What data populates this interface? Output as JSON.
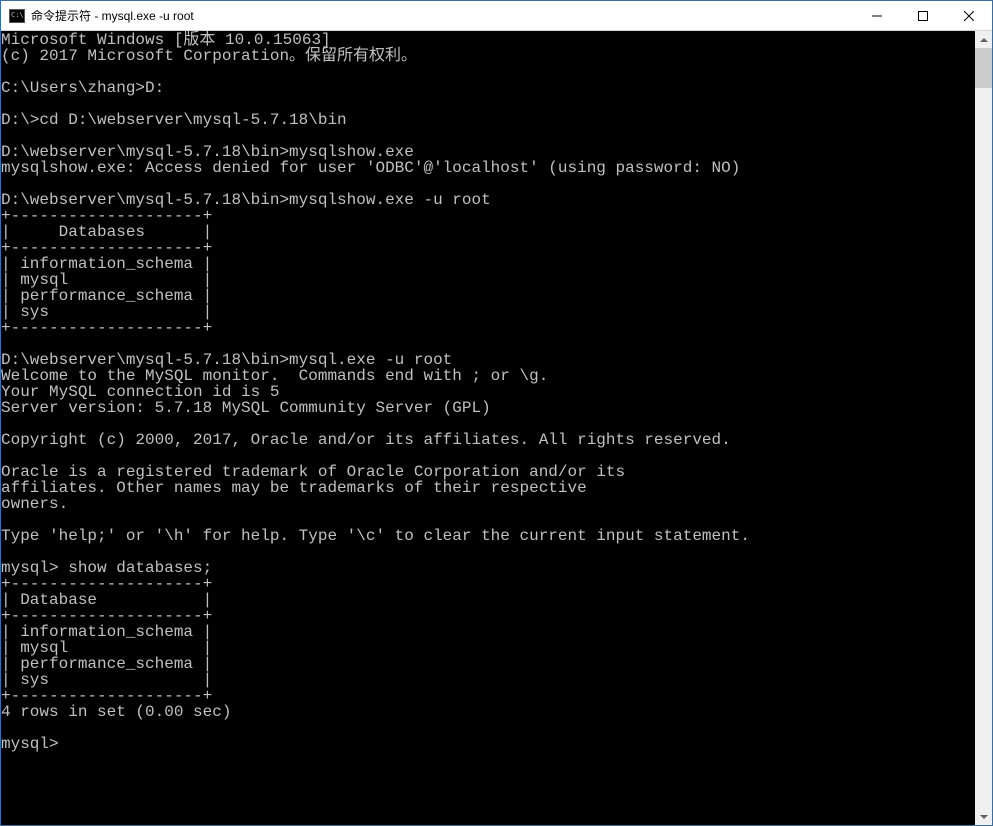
{
  "window": {
    "title": "命令提示符 - mysql.exe  -u root"
  },
  "terminal": {
    "lines": [
      "Microsoft Windows [版本 10.0.15063]",
      "(c) 2017 Microsoft Corporation。保留所有权利。",
      "",
      "C:\\Users\\zhang>D:",
      "",
      "D:\\>cd D:\\webserver\\mysql-5.7.18\\bin",
      "",
      "D:\\webserver\\mysql-5.7.18\\bin>mysqlshow.exe",
      "mysqlshow.exe: Access denied for user 'ODBC'@'localhost' (using password: NO)",
      "",
      "D:\\webserver\\mysql-5.7.18\\bin>mysqlshow.exe -u root",
      "+--------------------+",
      "|     Databases      |",
      "+--------------------+",
      "| information_schema |",
      "| mysql              |",
      "| performance_schema |",
      "| sys                |",
      "+--------------------+",
      "",
      "D:\\webserver\\mysql-5.7.18\\bin>mysql.exe -u root",
      "Welcome to the MySQL monitor.  Commands end with ; or \\g.",
      "Your MySQL connection id is 5",
      "Server version: 5.7.18 MySQL Community Server (GPL)",
      "",
      "Copyright (c) 2000, 2017, Oracle and/or its affiliates. All rights reserved.",
      "",
      "Oracle is a registered trademark of Oracle Corporation and/or its",
      "affiliates. Other names may be trademarks of their respective",
      "owners.",
      "",
      "Type 'help;' or '\\h' for help. Type '\\c' to clear the current input statement.",
      "",
      "mysql> show databases;",
      "+--------------------+",
      "| Database           |",
      "+--------------------+",
      "| information_schema |",
      "| mysql              |",
      "| performance_schema |",
      "| sys                |",
      "+--------------------+",
      "4 rows in set (0.00 sec)",
      "",
      "mysql>"
    ]
  }
}
